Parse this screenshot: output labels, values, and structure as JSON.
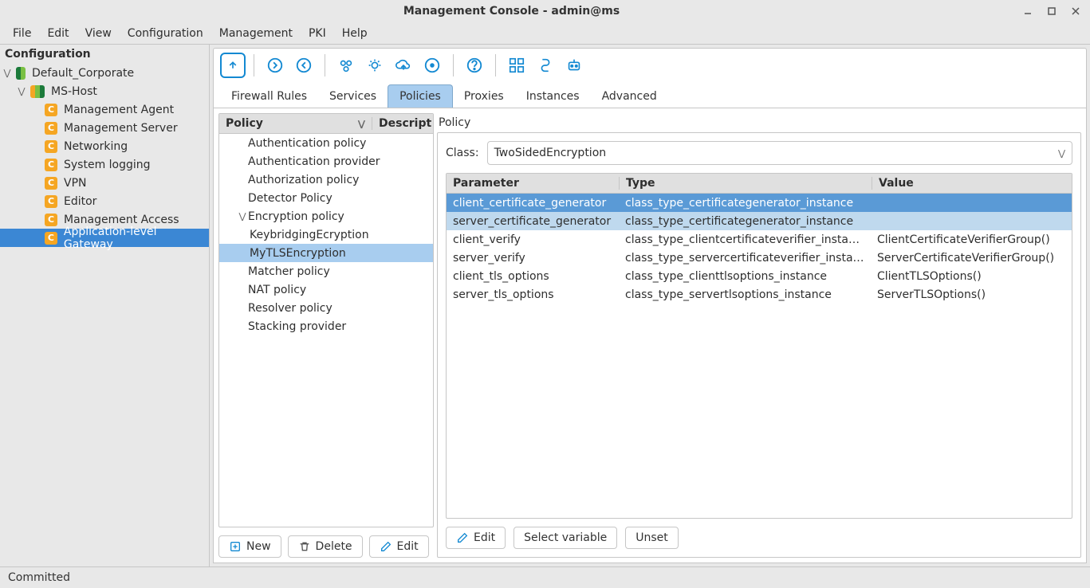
{
  "window": {
    "title": "Management Console - admin@ms"
  },
  "menubar": [
    "File",
    "Edit",
    "View",
    "Configuration",
    "Management",
    "PKI",
    "Help"
  ],
  "left": {
    "heading": "Configuration",
    "tree": {
      "root": {
        "label": "Default_Corporate",
        "expanded": true
      },
      "host": {
        "label": "MS-Host",
        "expanded": true
      },
      "items": [
        "Management Agent",
        "Management Server",
        "Networking",
        "System logging",
        "VPN",
        "Editor",
        "Management Access",
        "Application-level Gateway"
      ],
      "selected_index": 7
    }
  },
  "toolbar": {
    "icons": [
      "up-arrow-box",
      "circle-arrow-right",
      "circle-arrow-left",
      "eye-gear",
      "gear-arrows",
      "cloud-upload",
      "circle-dot",
      "help-circle",
      "dashboard",
      "snake",
      "robot"
    ]
  },
  "tabs": {
    "items": [
      "Firewall Rules",
      "Services",
      "Policies",
      "Proxies",
      "Instances",
      "Advanced"
    ],
    "active_index": 2
  },
  "policy_list": {
    "header": {
      "policy": "Policy",
      "desc": "Descript"
    },
    "rows": [
      {
        "label": "Authentication policy",
        "depth": 1
      },
      {
        "label": "Authentication provider",
        "depth": 1
      },
      {
        "label": "Authorization policy",
        "depth": 1
      },
      {
        "label": "Detector Policy",
        "depth": 1
      },
      {
        "label": "Encryption policy",
        "depth": 1,
        "expanded": true
      },
      {
        "label": "KeybridgingEcryption",
        "depth": 2
      },
      {
        "label": "MyTLSEncryption",
        "depth": 2,
        "selected": true
      },
      {
        "label": "Matcher policy",
        "depth": 1
      },
      {
        "label": "NAT policy",
        "depth": 1
      },
      {
        "label": "Resolver policy",
        "depth": 1
      },
      {
        "label": "Stacking provider",
        "depth": 1
      }
    ],
    "buttons": {
      "new": "New",
      "delete": "Delete",
      "edit": "Edit"
    }
  },
  "detail": {
    "section": "Policy",
    "class_label": "Class:",
    "class_value": "TwoSidedEncryption",
    "columns": {
      "param": "Parameter",
      "type": "Type",
      "value": "Value"
    },
    "rows": [
      {
        "param": "client_certificate_generator",
        "type": "class_type_certificategenerator_instance",
        "value": "",
        "sel": 1
      },
      {
        "param": "server_certificate_generator",
        "type": "class_type_certificategenerator_instance",
        "value": "",
        "sel": 2
      },
      {
        "param": "client_verify",
        "type": "class_type_clientcertificateverifier_instance",
        "value": "ClientCertificateVerifierGroup()"
      },
      {
        "param": "server_verify",
        "type": "class_type_servercertificateverifier_instance",
        "value": "ServerCertificateVerifierGroup()"
      },
      {
        "param": "client_tls_options",
        "type": "class_type_clienttlsoptions_instance",
        "value": "ClientTLSOptions()"
      },
      {
        "param": "server_tls_options",
        "type": "class_type_servertlsoptions_instance",
        "value": "ServerTLSOptions()"
      }
    ],
    "buttons": {
      "edit": "Edit",
      "select_var": "Select variable",
      "unset": "Unset"
    }
  },
  "status": {
    "text": "Committed"
  }
}
